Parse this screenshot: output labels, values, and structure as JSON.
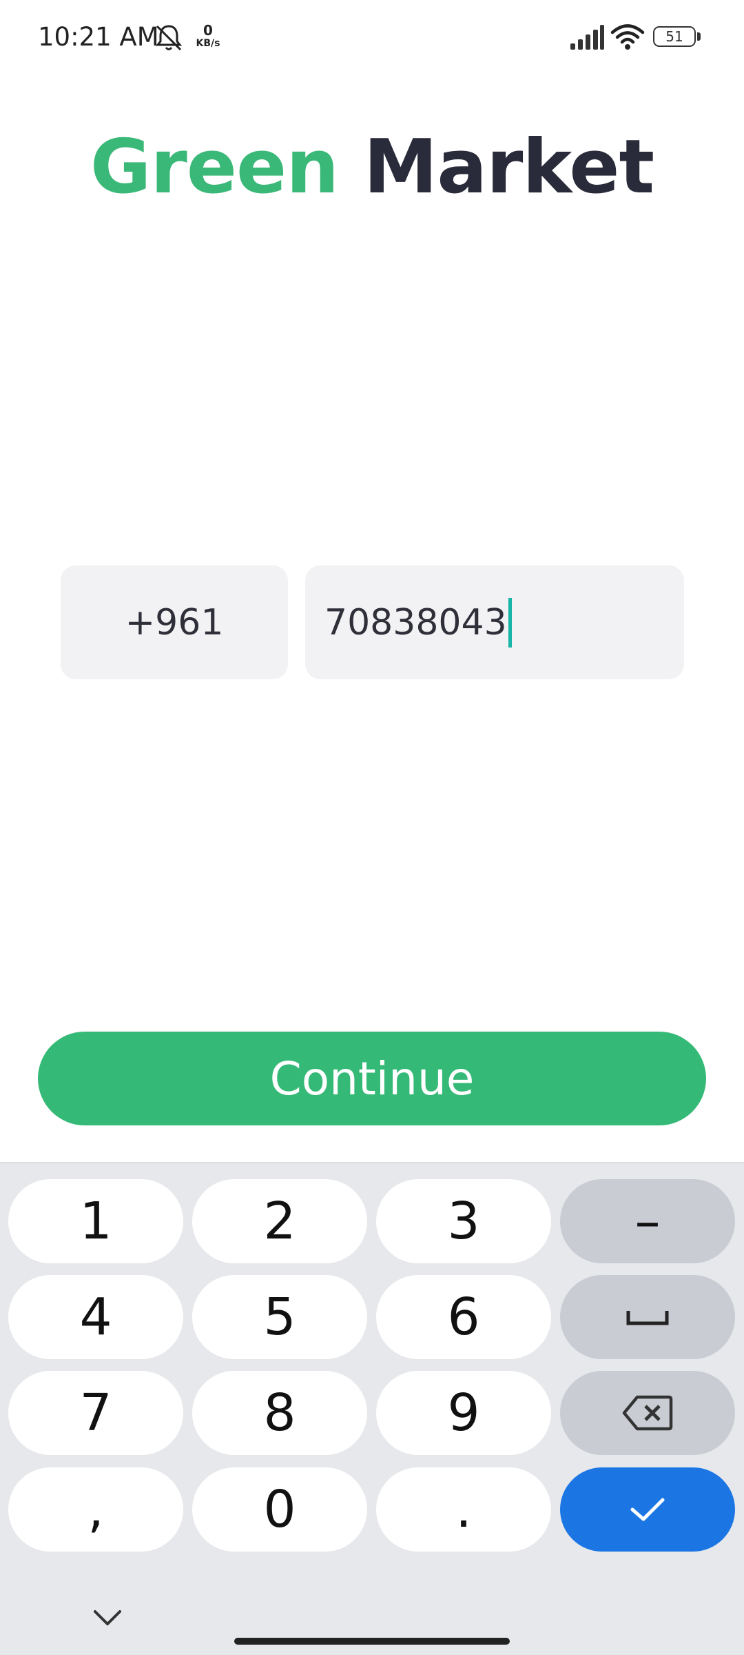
{
  "status_bar": {
    "time": "10:21 AM",
    "net_speed_value": "0",
    "net_speed_unit": "KB/s",
    "battery_level": "51",
    "icons": [
      "mute-bell-icon",
      "signal-icon",
      "wifi-icon",
      "battery-icon"
    ]
  },
  "header": {
    "brand_first": "Green",
    "brand_second": "Market"
  },
  "form": {
    "country_code": "+961",
    "phone_number": "70838043"
  },
  "actions": {
    "continue_label": "Continue"
  },
  "keyboard": {
    "keys": [
      "1",
      "2",
      "3",
      "–",
      "4",
      "5",
      "6",
      "␣",
      "7",
      "8",
      "9",
      "⌫",
      ",",
      "0",
      ".",
      "✓"
    ],
    "icons": [
      "space-icon",
      "backspace-icon",
      "check-icon",
      "chevron-down-icon"
    ]
  },
  "colors": {
    "brand_green": "#3ab878",
    "brand_dark": "#2a2b3a",
    "button_green": "#35b977",
    "enter_blue": "#1b76e4",
    "caret": "#17b6a7"
  }
}
